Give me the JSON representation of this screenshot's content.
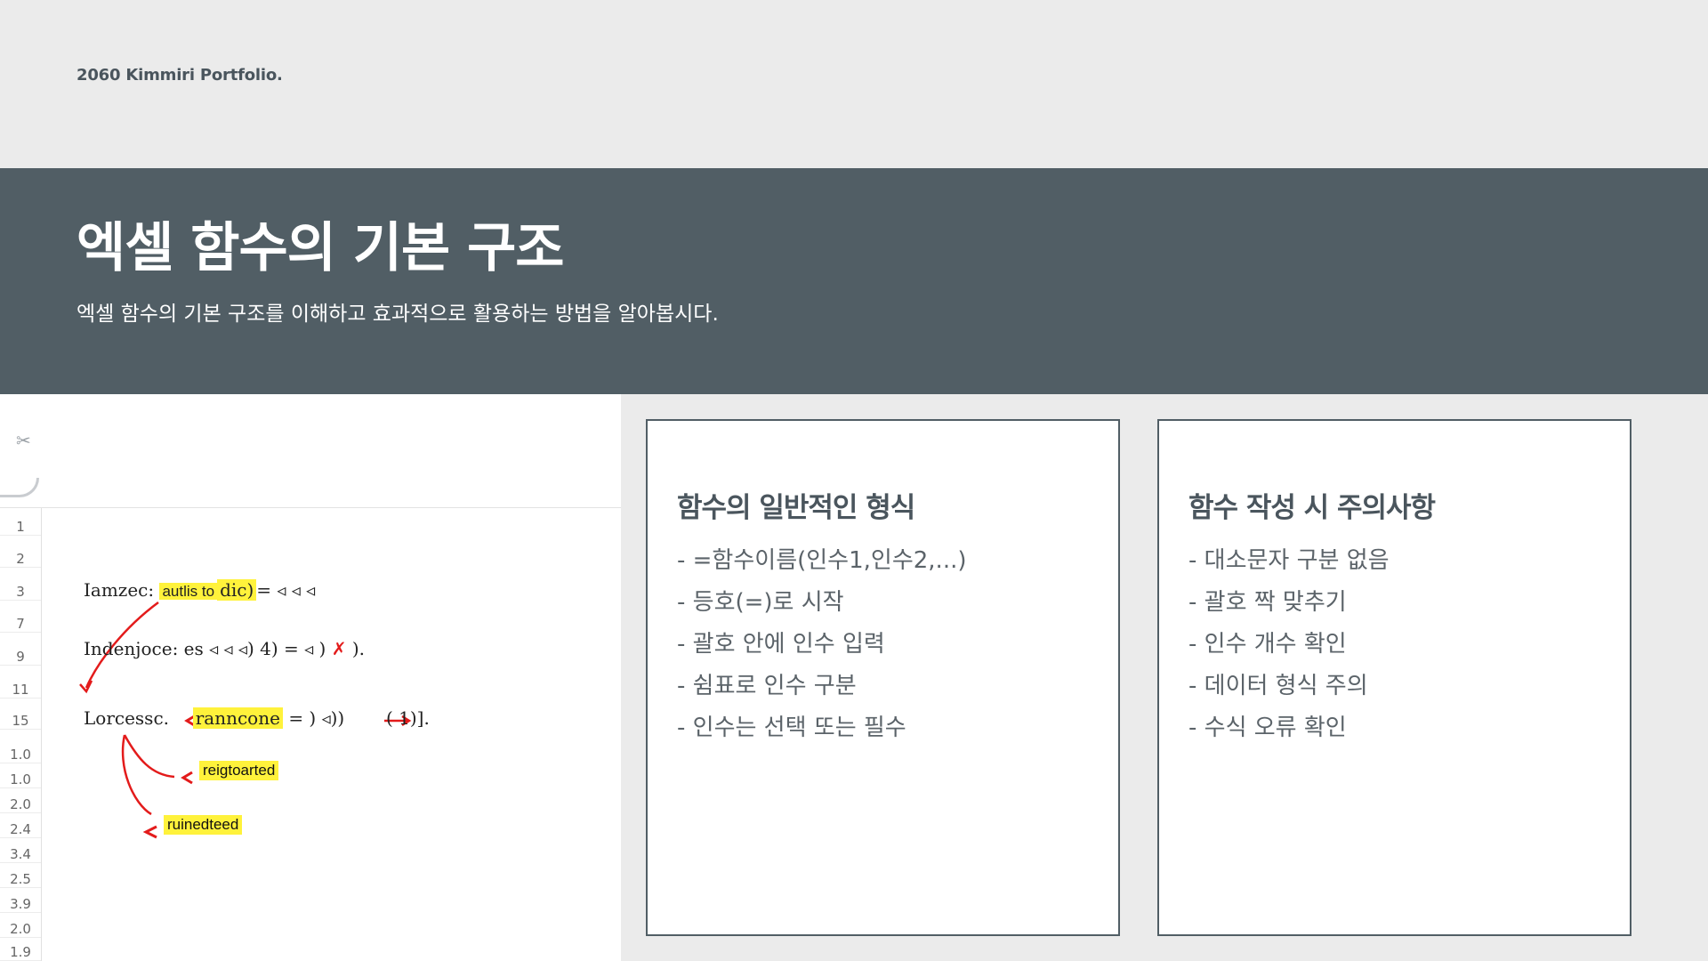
{
  "brand": "2060 Kimmiri Portfolio.",
  "hero": {
    "title": "엑셀 함수의 기본 구조",
    "subtitle": "엑셀 함수의 기본 구조를 이해하고 효과적으로 활용하는 방법을 알아봅시다."
  },
  "sheet": {
    "toolbar_icon": "scissors-icon",
    "row_numbers": [
      "1",
      "2",
      "3",
      "7",
      "9",
      "11",
      "15",
      "1.0",
      "1.0",
      "2.0",
      "2.4",
      "3.4",
      "2.5",
      "3.9",
      "2.0",
      "1.9"
    ],
    "lines": {
      "l1_prefix": "Iamzec:",
      "l1_highlight": "autlis to",
      "l1_highlight2": "dic)",
      "l1_suffix": "= ◃ ◃ ◃",
      "l2": "Indenjoce: es ◃ ◃ ◃) 4) = ◃ ) ",
      "l2_mark": "✗",
      "l2_end": ").",
      "l3_prefix": "Lorcessc.",
      "l3_highlight": "ranncone",
      "l3_suffix": "= ) ◃))",
      "l3_end": "( 1)].",
      "note1": "reigtoarted",
      "note2": "ruinedteed"
    },
    "accent_color": "#e31b1b",
    "highlight_color": "#fff23b"
  },
  "cards": [
    {
      "title": "함수의 일반적인 형식",
      "items": [
        "- =함수이름(인수1,인수2,...)",
        "- 등호(=)로 시작",
        "- 괄호 안에 인수 입력",
        "- 쉼표로 인수 구분",
        "- 인수는 선택 또는 필수"
      ]
    },
    {
      "title": "함수 작성 시 주의사항",
      "items": [
        "- 대소문자 구분 없음",
        "- 괄호 짝 맞추기",
        "- 인수 개수 확인",
        "- 데이터 형식 주의",
        "- 수식 오류 확인"
      ]
    }
  ],
  "colors": {
    "background": "#ebebeb",
    "hero": "#515e65",
    "card_border": "#515e65"
  }
}
